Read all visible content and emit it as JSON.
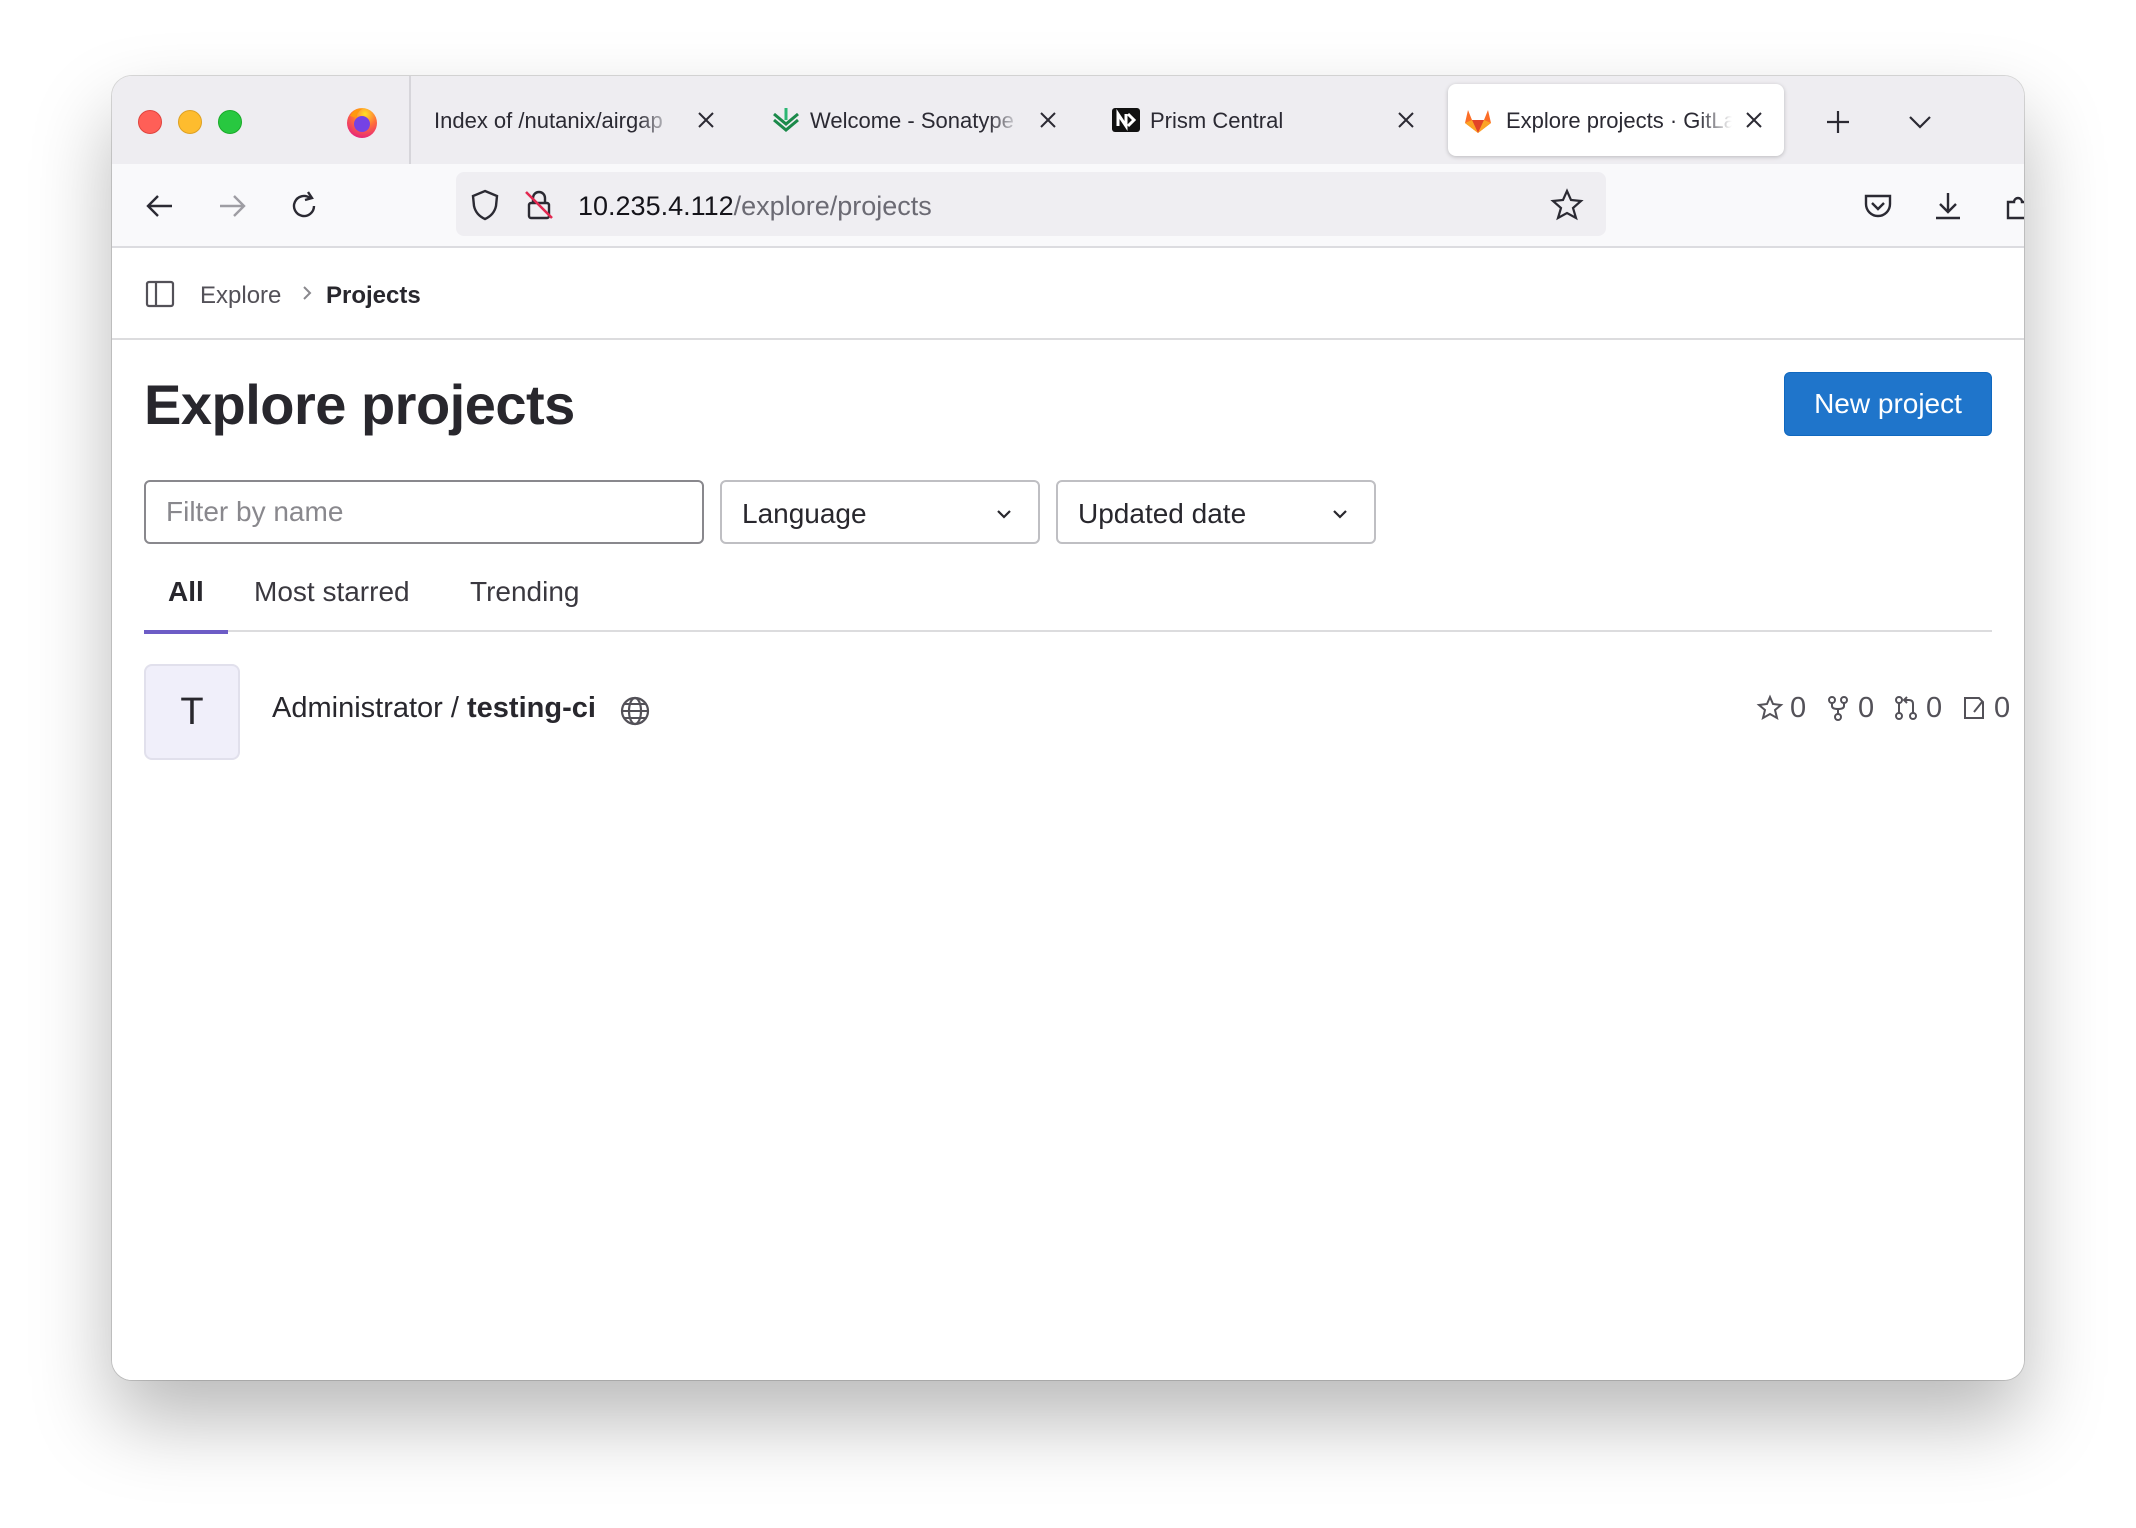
{
  "browser": {
    "tabs": [
      {
        "title": "Index of /nutanix/airgap",
        "favicon": "none",
        "active": false
      },
      {
        "title": "Welcome - Sonatype Nexus",
        "favicon": "sonatype-icon",
        "active": false
      },
      {
        "title": "Prism Central",
        "favicon": "nutanix-icon",
        "active": false
      },
      {
        "title": "Explore projects · GitLab",
        "favicon": "gitlab-icon",
        "active": true
      }
    ],
    "url": {
      "host": "10.235.4.112",
      "path": "/explore/projects"
    }
  },
  "breadcrumb": {
    "parent": "Explore",
    "current": "Projects"
  },
  "page": {
    "title": "Explore projects",
    "new_project_label": "New project",
    "filter_placeholder": "Filter by name",
    "language_label": "Language",
    "sort_label": "Updated date"
  },
  "tabs": {
    "all": "All",
    "most_starred": "Most starred",
    "trending": "Trending"
  },
  "projects": [
    {
      "avatar_letter": "T",
      "namespace": "Administrator /",
      "name": "testing-ci",
      "visibility": "public",
      "stars": "0",
      "forks": "0",
      "merge_requests": "0",
      "issues": "0"
    }
  ],
  "colors": {
    "primary": "#1f75cb",
    "tab_indicator": "#6d5cc6"
  }
}
